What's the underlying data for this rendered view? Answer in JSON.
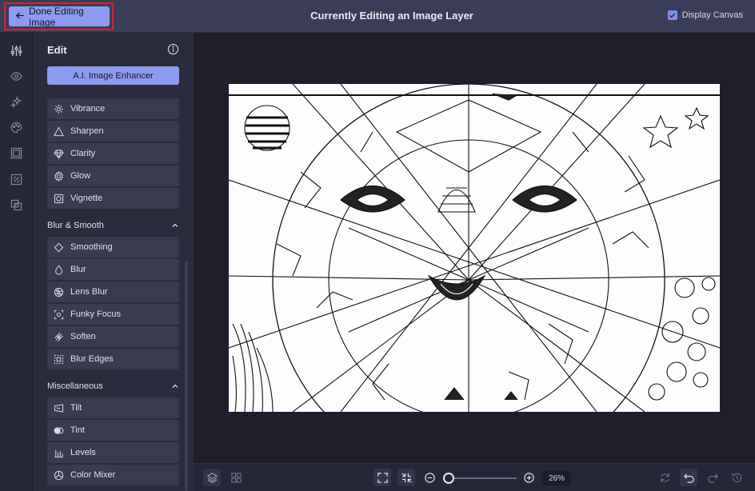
{
  "topbar": {
    "done_label": "Done Editing Image",
    "title": "Currently Editing an Image Layer",
    "display_canvas_label": "Display Canvas",
    "display_canvas_checked": true
  },
  "rail": {
    "icons": [
      "sliders-icon",
      "eye-icon",
      "sparkles-icon",
      "palette-icon",
      "frame-icon",
      "texture-icon",
      "overlay-icon"
    ]
  },
  "panel": {
    "title": "Edit",
    "enhancer_label": "A.I. Image Enhancer",
    "edit_items": [
      {
        "label": "Vibrance",
        "icon": "vibrance-icon"
      },
      {
        "label": "Sharpen",
        "icon": "triangle-icon"
      },
      {
        "label": "Clarity",
        "icon": "diamond-icon"
      },
      {
        "label": "Glow",
        "icon": "gear-glow-icon"
      },
      {
        "label": "Vignette",
        "icon": "vignette-icon"
      }
    ],
    "blur_section": {
      "title": "Blur & Smooth",
      "items": [
        {
          "label": "Smoothing",
          "icon": "rhombus-icon"
        },
        {
          "label": "Blur",
          "icon": "droplet-icon"
        },
        {
          "label": "Lens Blur",
          "icon": "aperture-icon"
        },
        {
          "label": "Funky Focus",
          "icon": "focus-icon"
        },
        {
          "label": "Soften",
          "icon": "soften-icon"
        },
        {
          "label": "Blur Edges",
          "icon": "blur-edges-icon"
        }
      ]
    },
    "misc_section": {
      "title": "Miscellaneous",
      "items": [
        {
          "label": "Tilt",
          "icon": "tilt-icon"
        },
        {
          "label": "Tint",
          "icon": "tint-icon"
        },
        {
          "label": "Levels",
          "icon": "levels-icon"
        },
        {
          "label": "Color Mixer",
          "icon": "color-mixer-icon"
        }
      ]
    }
  },
  "bottombar": {
    "zoom_value": "26%"
  }
}
